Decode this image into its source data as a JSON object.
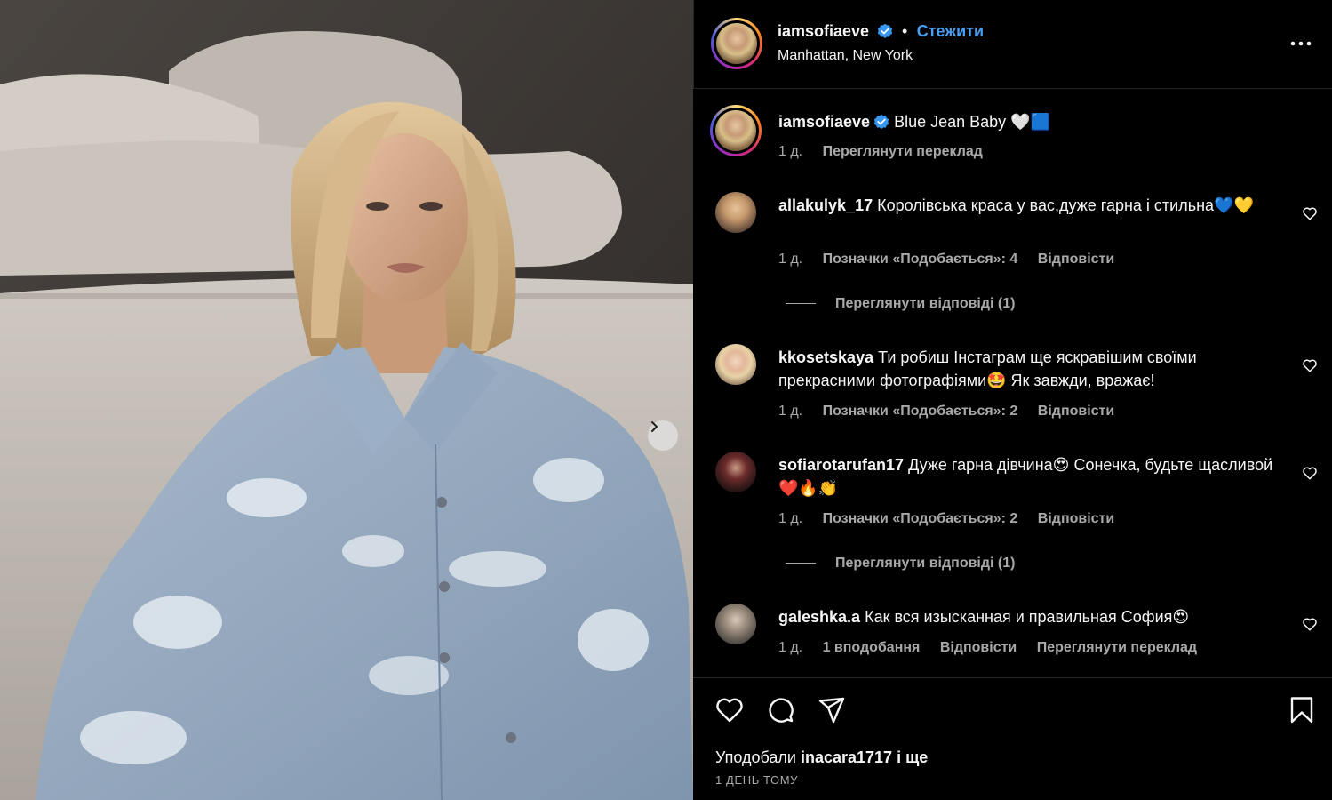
{
  "post": {
    "username": "iamsofiaeve",
    "follow_label": "Стежити",
    "location": "Manhattan, New York",
    "caption": "Blue Jean Baby 🤍🟦",
    "caption_time": "1 д.",
    "translate_label": "Переглянути переклад"
  },
  "comments": [
    {
      "username": "allakulyk_17",
      "text": "Королівська краса у вас,дуже гарна і стильна💙💛",
      "time": "1 д.",
      "likes": "Позначки «Подобається»: 4",
      "reply": "Відповісти",
      "view_replies": "Переглянути відповіді (1)"
    },
    {
      "username": "kkosetskaya",
      "text": "Ти робиш Інстаграм ще яскравішим своїми прекрасними фотографіями🤩 Як завжди, вражає!",
      "time": "1 д.",
      "likes": "Позначки «Подобається»: 2",
      "reply": "Відповісти"
    },
    {
      "username": "sofiarotarufan17",
      "text": "Дуже гарна дівчина😍 Сонечка, будьте щасливой❤️🔥👏",
      "time": "1 д.",
      "likes": "Позначки «Подобається»: 2",
      "reply": "Відповісти",
      "view_replies": "Переглянути відповіді (1)"
    },
    {
      "username": "galeshka.a",
      "text": "Как вся изысканная и правильная София😍",
      "time": "1 д.",
      "likes": "1 вподобання",
      "reply": "Відповісти",
      "translate": "Переглянути переклад"
    }
  ],
  "footer": {
    "liked_by_prefix": "Уподобали",
    "liked_by_user": "inacara1717",
    "liked_by_suffix": "і ще",
    "date": "1 ДЕНЬ ТОМУ"
  },
  "icons": [
    "verified-badge-icon",
    "more-icon",
    "heart-icon",
    "comment-icon",
    "share-icon",
    "bookmark-icon",
    "chevron-right-icon"
  ],
  "colors": {
    "follow": "#4a9ff5",
    "verified": "#3897f0",
    "background": "#000000",
    "muted": "#a8a8a8"
  }
}
